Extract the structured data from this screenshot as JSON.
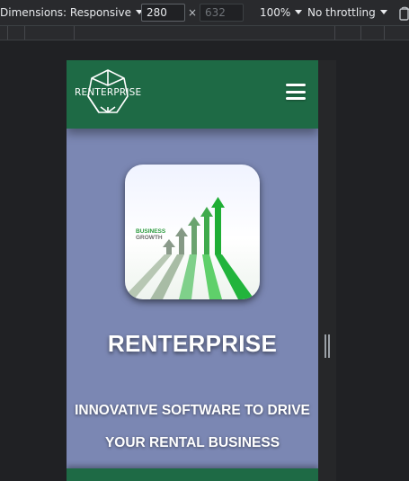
{
  "devtools": {
    "dimensions_label": "Dimensions: Responsive",
    "width_value": "280",
    "height_placeholder": "632",
    "times_symbol": "×",
    "zoom": "100%",
    "throttling": "No throttling",
    "icons": [
      "caret-down-icon",
      "rotate-icon"
    ]
  },
  "site": {
    "logo_text": "RENTERPRISE",
    "menu_icon": "hamburger-menu-icon",
    "hero": {
      "image_text_line1": "BUSINESS",
      "image_text_line2": "GROWTH",
      "title": "RENTERPRISE",
      "subtitle_line1": "INNOVATIVE SOFTWARE TO DRIVE",
      "subtitle_line2": "YOUR RENTAL BUSINESS"
    }
  },
  "colors": {
    "header_green": "#1e6a45",
    "hero_background": "#7b87b3",
    "devtools_bg": "#292a2d",
    "arrow_green": "#22b43c"
  }
}
